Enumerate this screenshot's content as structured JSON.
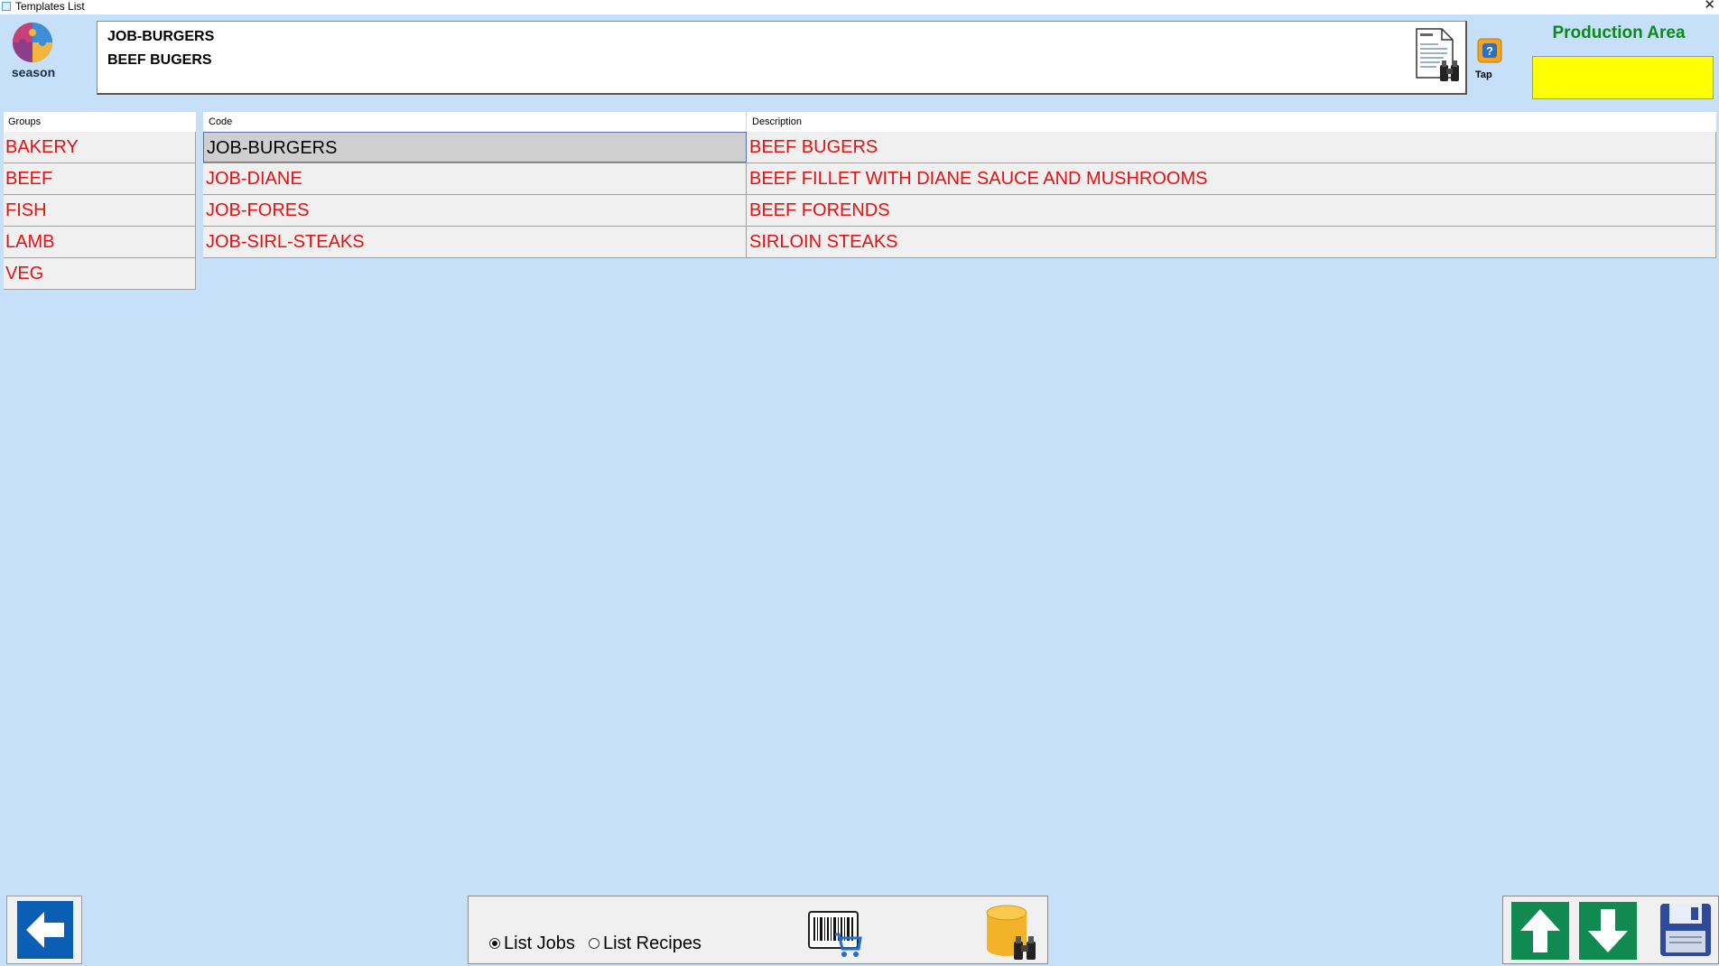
{
  "window": {
    "title": "Templates List",
    "close_glyph": "✕"
  },
  "logo": {
    "text": "season"
  },
  "header": {
    "code": "JOB-BURGERS",
    "description": "BEEF BUGERS",
    "tap_label": "Tap",
    "production_area_label": "Production Area",
    "production_area_value": ""
  },
  "groups": {
    "header": "Groups",
    "items": [
      "BAKERY",
      "BEEF",
      "FISH",
      "LAMB",
      "VEG"
    ]
  },
  "templates": {
    "columns": {
      "code": "Code",
      "description": "Description"
    },
    "rows": [
      {
        "code": "JOB-BURGERS",
        "description": "BEEF BUGERS",
        "selected": true
      },
      {
        "code": "JOB-DIANE",
        "description": "BEEF FILLET WITH DIANE SAUCE AND MUSHROOMS",
        "selected": false
      },
      {
        "code": "JOB-FORES",
        "description": "BEEF FORENDS",
        "selected": false
      },
      {
        "code": "JOB-SIRL-STEAKS",
        "description": "SIRLOIN STEAKS",
        "selected": false
      }
    ]
  },
  "footer": {
    "list_jobs_label": "List Jobs",
    "list_recipes_label": "List Recipes",
    "list_mode": "jobs"
  },
  "colors": {
    "background": "#c6e0fa",
    "item_text": "#e81010",
    "production_area_title": "#0a8a1a",
    "production_area_field": "#ffff00",
    "nav_button": "#108a50",
    "back_button": "#0a5fb4"
  }
}
